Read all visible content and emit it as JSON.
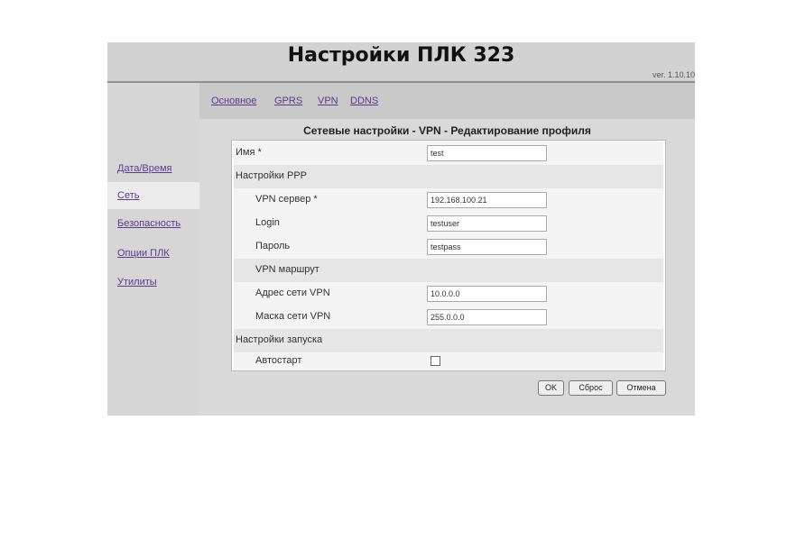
{
  "header": {
    "title": "Настройки ПЛК 323",
    "version": "ver. 1.10.10"
  },
  "sidebar": {
    "items": [
      {
        "label": "Дата/Время"
      },
      {
        "label": "Сеть"
      },
      {
        "label": "Безопасность"
      },
      {
        "label": "Опции ПЛК"
      },
      {
        "label": "Утилиты"
      }
    ],
    "active_index": 1
  },
  "tabs": [
    {
      "label": "Основное"
    },
    {
      "label": "GPRS"
    },
    {
      "label": "VPN"
    },
    {
      "label": "DDNS"
    }
  ],
  "section_title": "Сетевые настройки - VPN - Редактирование профиля",
  "form": {
    "name_label": "Имя *",
    "name_value": "test",
    "ppp_section": "Настройки PPP",
    "vpn_server_label": "VPN сервер *",
    "vpn_server_value": "192.168.100.21",
    "login_label": "Login",
    "login_value": "testuser",
    "password_label": "Пароль",
    "password_value": "testpass",
    "route_section": "VPN маршрут",
    "net_addr_label": "Адрес сети VPN",
    "net_addr_value": "10.0.0.0",
    "net_mask_label": "Маска сети VPN",
    "net_mask_value": "255.0.0.0",
    "startup_section": "Настройки запуска",
    "autostart_label": "Автостарт",
    "autostart_checked": false
  },
  "buttons": {
    "ok": "OK",
    "reset": "Сброс",
    "cancel": "Отмена"
  }
}
